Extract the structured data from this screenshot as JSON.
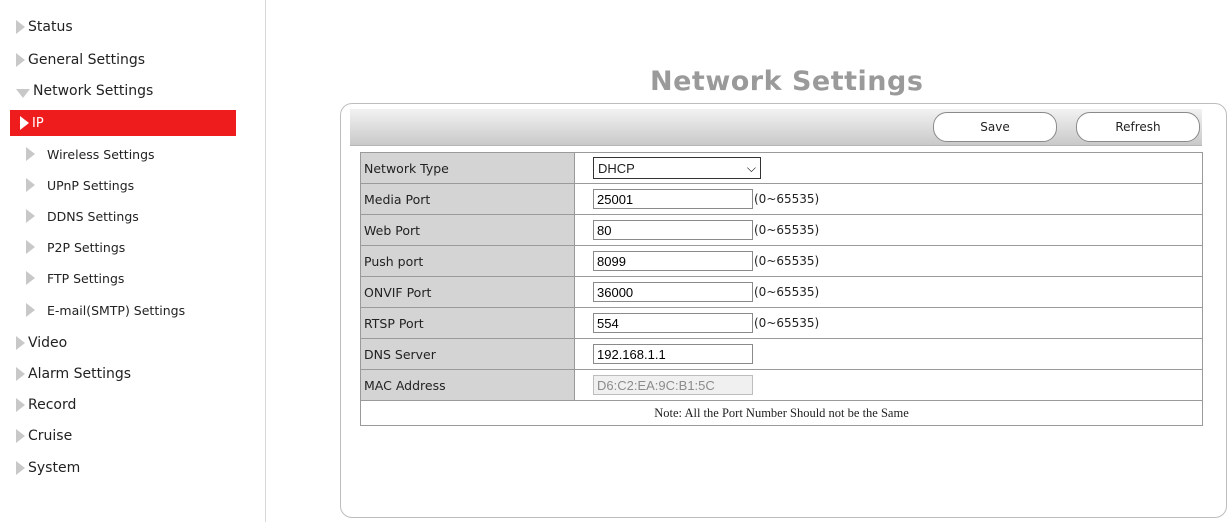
{
  "sidebar": {
    "items": [
      {
        "label": "Status",
        "expanded": false
      },
      {
        "label": "General Settings",
        "expanded": false
      },
      {
        "label": "Network Settings",
        "expanded": true,
        "children": [
          {
            "label": "IP",
            "active": true
          },
          {
            "label": "Wireless Settings"
          },
          {
            "label": "UPnP Settings"
          },
          {
            "label": "DDNS Settings"
          },
          {
            "label": "P2P Settings"
          },
          {
            "label": "FTP Settings"
          },
          {
            "label": "E-mail(SMTP) Settings"
          }
        ]
      },
      {
        "label": "Video",
        "expanded": false
      },
      {
        "label": "Alarm Settings",
        "expanded": false
      },
      {
        "label": "Record",
        "expanded": false
      },
      {
        "label": "Cruise",
        "expanded": false
      },
      {
        "label": "System",
        "expanded": false
      }
    ]
  },
  "main": {
    "title": "Network Settings",
    "toolbar": {
      "save_label": "Save",
      "refresh_label": "Refresh"
    },
    "form": {
      "rows": [
        {
          "label": "Network Type",
          "type": "select",
          "value": "DHCP"
        },
        {
          "label": "Media Port",
          "type": "input",
          "value": "25001",
          "range": "(0~65535)"
        },
        {
          "label": "Web Port",
          "type": "input",
          "value": "80",
          "range": "(0~65535)"
        },
        {
          "label": "Push port",
          "type": "input",
          "value": "8099",
          "range": "(0~65535)"
        },
        {
          "label": "ONVIF Port",
          "type": "input",
          "value": "36000",
          "range": "(0~65535)"
        },
        {
          "label": "RTSP Port",
          "type": "input",
          "value": "554",
          "range": "(0~65535)"
        },
        {
          "label": "DNS Server",
          "type": "input",
          "value": "192.168.1.1"
        },
        {
          "label": "MAC Address",
          "type": "input",
          "value": "D6:C2:EA:9C:B1:5C",
          "disabled": true
        }
      ],
      "note": "Note: All the Port Number Should not be the Same"
    }
  },
  "colors": {
    "active": "#ee1c1c",
    "title": "#9a9a9a",
    "label_bg": "#d4d4d4",
    "arrow": "#c8c8c8"
  }
}
